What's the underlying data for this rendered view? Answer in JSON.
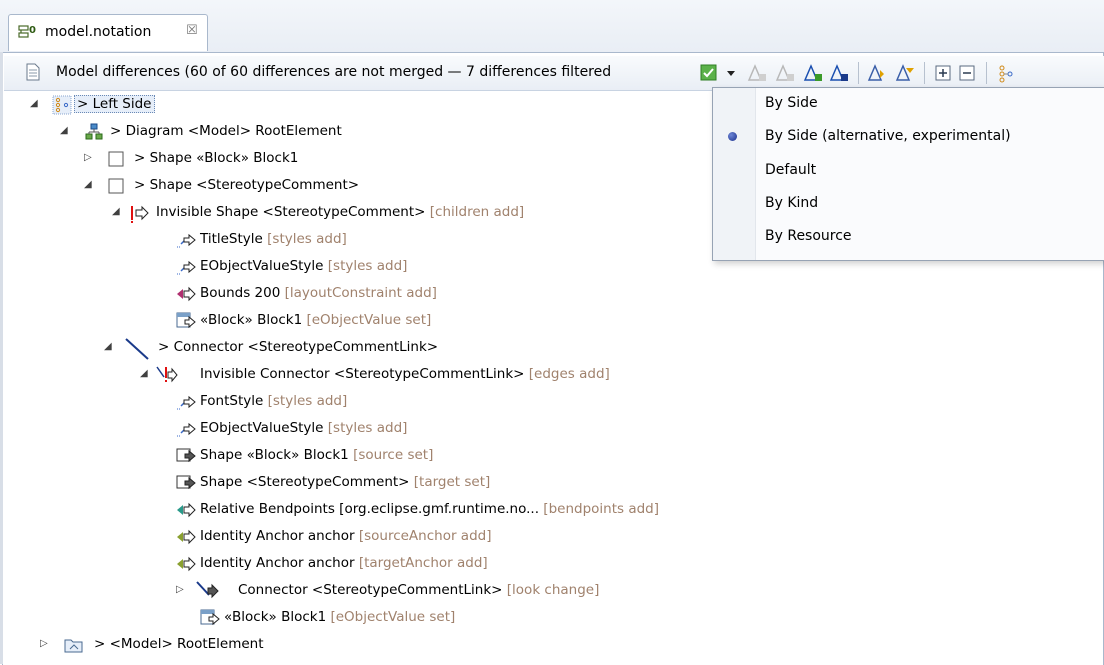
{
  "tab": {
    "label": "model.notation",
    "close_glyph": "☒"
  },
  "toolbar": {
    "title": "Model differences  (60 of 60 differences are not merged — 7 differences filtered",
    "icons": [
      "filter-check-icon",
      "dropdown-arrow-icon",
      "accept-change-icon",
      "reject-change-icon",
      "accept-all-icon",
      "reject-all-icon",
      "next-difference-icon",
      "previous-difference-icon",
      "expand-all-icon",
      "collapse-all-icon",
      "group-icon"
    ]
  },
  "tree": {
    "rows": [
      {
        "label": "> Left Side",
        "note": "",
        "icon": "group-icon"
      },
      {
        "label": "> Diagram <Model> RootElement",
        "note": "",
        "icon": "diagram-icon"
      },
      {
        "label": "> Shape «Block» Block1",
        "note": "",
        "icon": "shape-icon"
      },
      {
        "label": "> Shape <StereotypeComment>",
        "note": "",
        "icon": "shape-icon"
      },
      {
        "label": "Invisible Shape <StereotypeComment>",
        "note": "[children add]",
        "icon": "conflict-add-icon"
      },
      {
        "label": "TitleStyle",
        "note": "[styles add]",
        "icon": "style-add-icon"
      },
      {
        "label": "EObjectValueStyle",
        "note": "[styles add]",
        "icon": "style-add-icon"
      },
      {
        "label": "Bounds 200",
        "note": "[layoutConstraint add]",
        "icon": "bounds-add-icon"
      },
      {
        "label": "«Block» Block1",
        "note": "[eObjectValue set]",
        "icon": "stereotype-set-icon"
      },
      {
        "label": "> Connector <StereotypeCommentLink>",
        "note": "",
        "icon": "connector-icon"
      },
      {
        "label": "Invisible Connector <StereotypeCommentLink>",
        "note": "[edges add]",
        "icon": "conflict-add-icon"
      },
      {
        "label": "FontStyle",
        "note": "[styles add]",
        "icon": "style-add-icon"
      },
      {
        "label": "EObjectValueStyle",
        "note": "[styles add]",
        "icon": "style-add-icon"
      },
      {
        "label": "Shape «Block» Block1",
        "note": "[source set]",
        "icon": "shape-set-icon"
      },
      {
        "label": "Shape <StereotypeComment>",
        "note": "[target set]",
        "icon": "shape-set-icon"
      },
      {
        "label": "Relative Bendpoints [org.eclipse.gmf.runtime.no...",
        "note": "[bendpoints add]",
        "icon": "bendpoints-add-icon"
      },
      {
        "label": "Identity Anchor anchor",
        "note": "[sourceAnchor add]",
        "icon": "anchor-add-icon"
      },
      {
        "label": "Identity Anchor anchor",
        "note": "[targetAnchor add]",
        "icon": "anchor-add-icon"
      },
      {
        "label": "Connector <StereotypeCommentLink>",
        "note": "[look change]",
        "icon": "connector-change-icon"
      },
      {
        "label": "«Block» Block1",
        "note": "[eObjectValue set]",
        "icon": "stereotype-set-icon"
      },
      {
        "label": "> <Model> RootElement",
        "note": "",
        "icon": "model-icon"
      }
    ]
  },
  "menu": {
    "items": [
      {
        "label": "By Side",
        "selected": false
      },
      {
        "label": "By Side (alternative, experimental)",
        "selected": true
      },
      {
        "label": "Default",
        "selected": false
      },
      {
        "label": "By Kind",
        "selected": false
      },
      {
        "label": "By Resource",
        "selected": false
      }
    ]
  },
  "colors": {
    "note": "#a0826d",
    "selection_bg": "#e6eef9",
    "frame": "#a9b8cc"
  }
}
